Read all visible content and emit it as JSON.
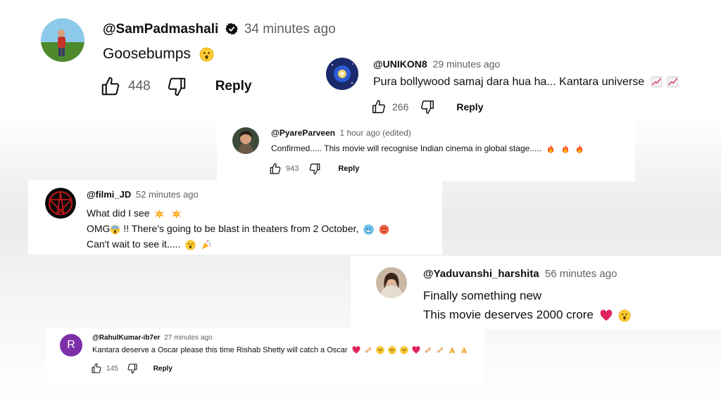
{
  "comments": [
    {
      "handle": "@SamPadmashali",
      "time": "34 minutes ago",
      "verified_icon": "verified-check-icon",
      "lines": [
        "Goosebumps"
      ],
      "emojis": [
        "astonished-face-icon"
      ],
      "likes": "448",
      "reply_label": "Reply"
    },
    {
      "handle": "@UNIKON8",
      "time": "29 minutes ago",
      "lines": [
        "Pura bollywood samaj dara hua ha... Kantara universe"
      ],
      "emojis": [
        "chart-increasing-icon",
        "chart-increasing-icon"
      ],
      "likes": "266",
      "reply_label": "Reply"
    },
    {
      "handle": "@PyareParveen",
      "time": "1 hour ago (edited)",
      "lines": [
        "Confirmed..... This movie will recognise Indian cinema in global stage....."
      ],
      "emojis": [
        "fire-icon",
        "fire-icon",
        "fire-icon"
      ],
      "likes": "943",
      "reply_label": "Reply"
    },
    {
      "handle": "@filmi_JD",
      "time": "52 minutes ago",
      "lines": [
        "What did I see",
        "OMG",
        "!!  There's going to be blast in theaters from 2 October,",
        "Can't wait to see it....."
      ],
      "emojis": [
        "collision-icon",
        "scream-face-icon",
        "cold-face-icon",
        "hot-face-icon",
        "astonished-face-icon",
        "party-popper-icon"
      ]
    },
    {
      "handle": "@Yaduvanshi_harshita",
      "time": "56 minutes ago",
      "lines": [
        "Finally something new",
        "This movie deserves 2000 crore"
      ],
      "emojis": [
        "red-heart-icon",
        "astonished-face-icon"
      ]
    },
    {
      "handle": "@RahulKumar-ib7er",
      "time": "27 minutes ago",
      "avatar_letter": "R",
      "lines": [
        "Kantara deserve a Oscar please this time Rishab Shetty will catch a Oscar"
      ],
      "emojis": [
        "red-heart-icon",
        "bandage-icon",
        "pleading-face-icon",
        "folded-hands-icon"
      ],
      "likes": "145",
      "reply_label": "Reply"
    }
  ],
  "colors": {
    "text": "#0f0f0f",
    "meta": "#606060",
    "heart": "#e0245e",
    "avatar_r": "#7b2fa8"
  }
}
